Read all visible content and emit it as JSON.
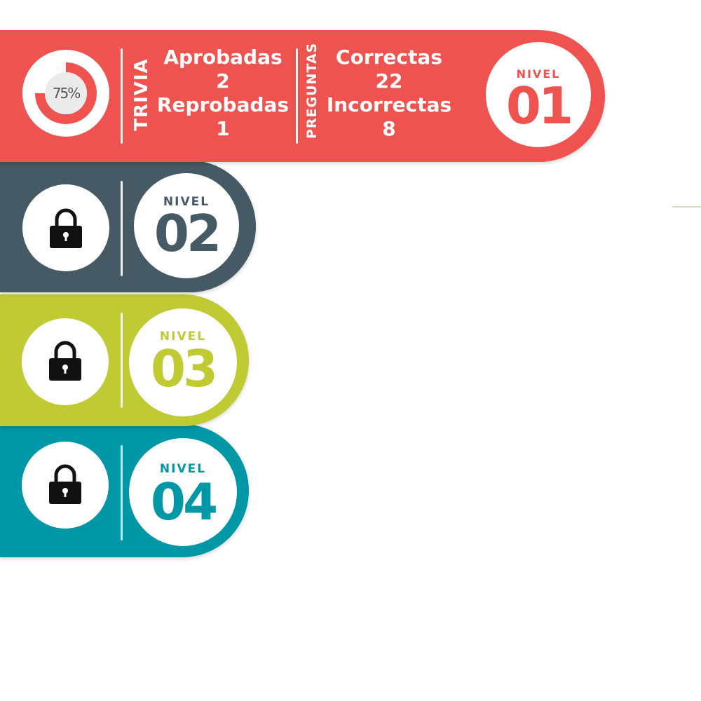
{
  "colors": {
    "level1": "#ef5350",
    "level2": "#455a64",
    "level3": "#c0ca33",
    "level4": "#0097a7"
  },
  "level1": {
    "progress_text": "75%",
    "progress_value": 0.75,
    "trivia_label": "TRIVIA",
    "aprobadas_label": "Aprobadas",
    "aprobadas_value": "2",
    "reprobadas_label": "Reprobadas",
    "reprobadas_value": "1",
    "preguntas_label": "PREGUNTAS",
    "correctas_label": "Correctas",
    "correctas_value": "22",
    "incorrectas_label": "Incorrectas",
    "incorrectas_value": "8",
    "nivel_label": "NIVEL",
    "nivel_number": "01"
  },
  "level2": {
    "lock_icon": "lock-icon",
    "nivel_label": "NIVEL",
    "nivel_number": "02"
  },
  "level3": {
    "lock_icon": "lock-icon",
    "nivel_label": "NIVEL",
    "nivel_number": "03"
  },
  "level4": {
    "lock_icon": "lock-icon",
    "nivel_label": "NIVEL",
    "nivel_number": "04"
  }
}
